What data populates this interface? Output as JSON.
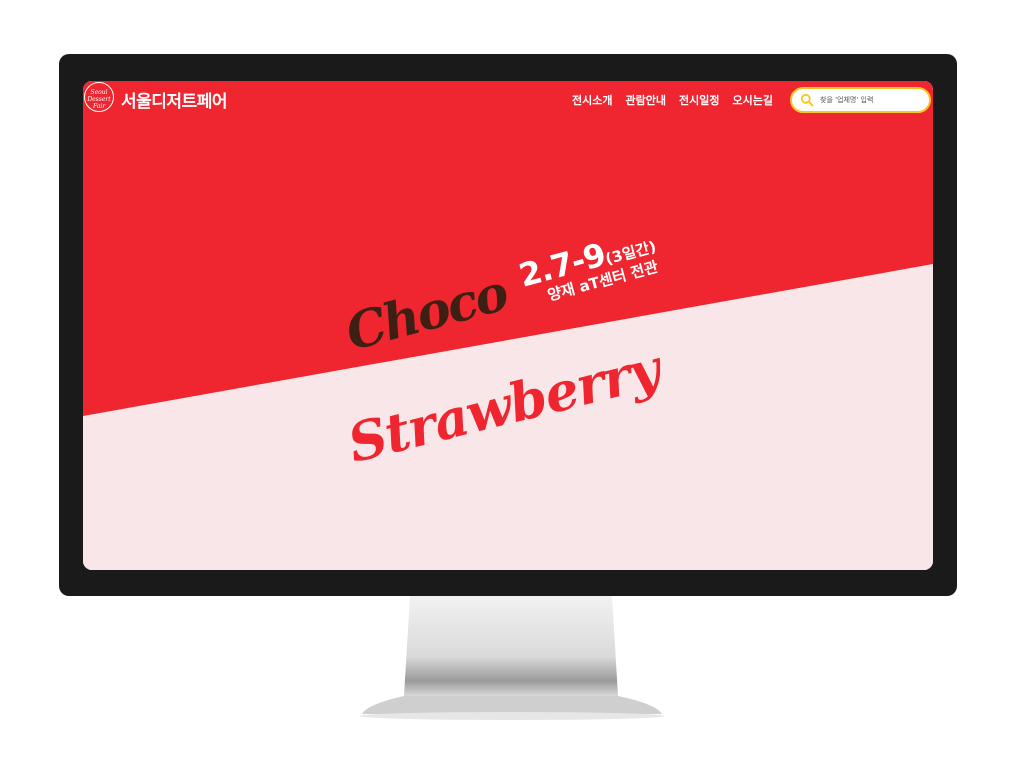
{
  "colors": {
    "accent_red": "#ef2630",
    "pink_bg": "#f9e6e8",
    "choco_brown": "#3d1f14",
    "search_border": "#f6c626",
    "frame": "#1a1a1a"
  },
  "header": {
    "logo_text": "Seoul Dessert Fair",
    "brand": "서울디저트페어",
    "nav": [
      "전시소개",
      "관람안내",
      "전시일정",
      "오시는길"
    ],
    "search": {
      "placeholder": "찾을 '업체명' 입력",
      "icon": "search-icon"
    }
  },
  "hero": {
    "choco": "Choco",
    "date": "2.7-9",
    "date_duration": "(3일간)",
    "venue": "양재 aT센터 전관",
    "strawberry": "Strawberry"
  }
}
